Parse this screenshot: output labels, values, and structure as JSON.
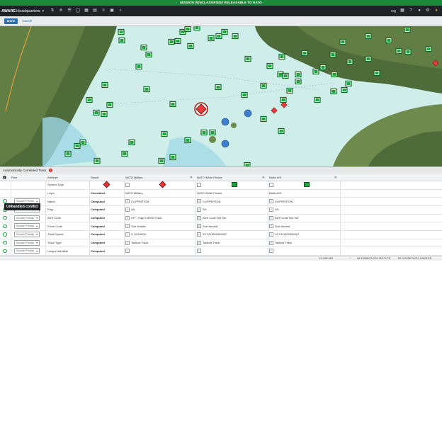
{
  "classification_banner": "MISSION //UNCLASSIFIED// RELEASABLE TO NATO",
  "header": {
    "brand": "AWARE",
    "org": "Headquarters",
    "hq_label": "HQ",
    "toolbar_icons": [
      "layers-icon",
      "hierarchy-icon",
      "list-icon",
      "chat-icon",
      "grid-icon",
      "table-icon",
      "stack-icon",
      "document-icon",
      "search-icon"
    ],
    "right_icons": [
      "calendar-icon",
      "help-icon",
      "user-icon",
      "settings-icon",
      "bell-icon"
    ]
  },
  "actions": {
    "done": "Done",
    "cancel": "Cancel"
  },
  "panel": {
    "title": "Automatically Correlated Track",
    "warning_count": "1"
  },
  "table": {
    "columns": {
      "rule": "Rule",
      "attribute": "Attribute",
      "result": "Result",
      "source1": "NATO Military",
      "source2": "NATO White Picture",
      "source3": "Baltic AIS"
    },
    "rows": [
      {
        "attribute": "Symbol Type",
        "result": "",
        "s1": "",
        "s2": "",
        "s3": ""
      },
      {
        "attribute": "Layer",
        "result": "Correlated",
        "s1": "NATO Military",
        "s2": "NATO White Picture",
        "s3": "Baltic AIS"
      },
      {
        "rule": "Source Priority",
        "attribute": "Name",
        "result": "Computed",
        "s1": "CLIPPERTON",
        "s2": "CLIPPERTON",
        "s3": "CLIPPERTON"
      },
      {
        "rule": "Source Priority",
        "attribute": "Flag",
        "result": "Computed",
        "s1": "AA",
        "s2": "SH",
        "s3": "SH"
      },
      {
        "rule": "Source Priority",
        "attribute": "Alert Code",
        "result": "Computed",
        "s1": "HIT - High Interest Track",
        "s2": "Alert Code Not Set",
        "s3": "Alert Code Not Set"
      },
      {
        "rule": "Source Priority",
        "attribute": "Force Code",
        "result": "Computed",
        "s1": "Surf Hostile",
        "s2": "Surf Neutral",
        "s3": "Surf Neutral"
      },
      {
        "rule": "Source Priority",
        "attribute": "Track Speed",
        "result": "Computed",
        "s1": "5.74119004",
        "s2": "13.7411900999997",
        "s3": "13.7411900999997"
      },
      {
        "rule": "Source Priority",
        "attribute": "Track Type",
        "result": "Computed",
        "s1": "Tactical Track",
        "s2": "Tactical Track",
        "s3": "Tactical Track"
      },
      {
        "rule": "Source Priority",
        "attribute": "Unique Identifier",
        "result": "Computed",
        "s1": "",
        "s2": "",
        "s3": ""
      }
    ]
  },
  "tooltip": "Unhandled conflict",
  "status": {
    "scale": "1:3,685,890",
    "coord1": "58.439564°N 020.390712°E",
    "coord2": "60.224056°N 021.188233°E"
  },
  "colors": {
    "classification": "#1a8a3a",
    "topbar": "#1f2326",
    "accent": "#2f6fb0",
    "sea": "#cfeeea",
    "land": "#4e6b3a",
    "hostile": "#e53b3b",
    "friendly_symbol": "#1aa53a"
  }
}
